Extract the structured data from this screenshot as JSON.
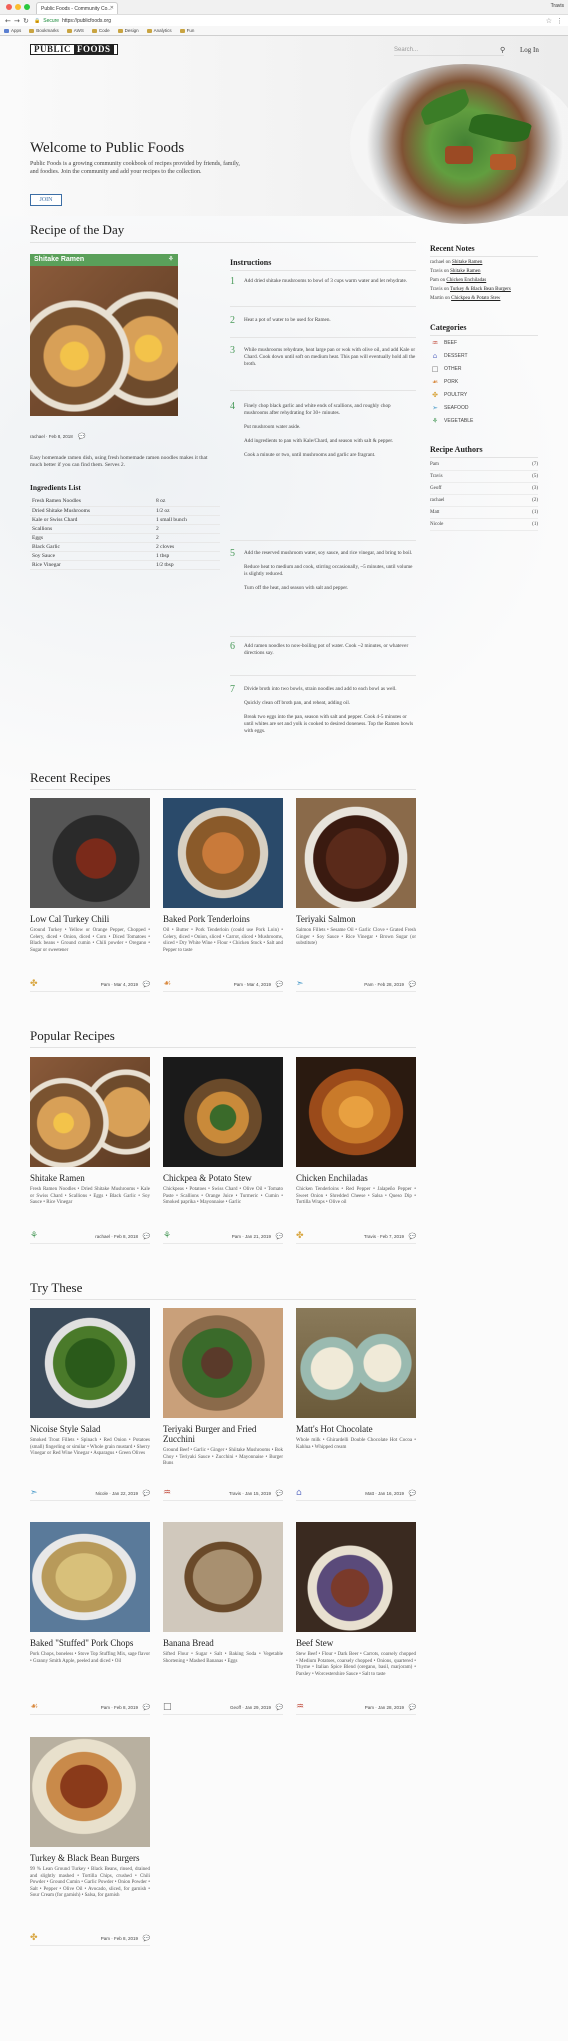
{
  "browser": {
    "tab_title": "Public Foods - Community Co...",
    "user": "Travis",
    "url_secure": "Secure",
    "url": "https://publicfoods.org",
    "bookmarks": [
      "Apps",
      "Bookmarks",
      "AWS",
      "Code",
      "Design",
      "Analytics",
      "Fun"
    ]
  },
  "header": {
    "logo_left": "PUBLIC",
    "logo_right": "FOODS",
    "search_placeholder": "Search...",
    "login": "Log In",
    "hero_title": "Welcome to Public Foods",
    "hero_sub": "Public Foods is a growing community cookbook of recipes provided by friends, family, and foodies. Join the community and add your recipes to the collection.",
    "join": "JOIN"
  },
  "rotd": {
    "section_title": "Recipe of the Day",
    "recipe_title": "Shitake Ramen",
    "author_line": "rachael · Feb 8, 2018",
    "description": "Easy homemade ramen dish, using fresh homemade ramen noodles makes it that much better if you can find them. Serves 2.",
    "ingredients_title": "Ingredients List",
    "ingredients": [
      [
        "Fresh Ramen Noodles",
        "8 oz"
      ],
      [
        "Dried Shitake Mushrooms",
        "1/2 oz"
      ],
      [
        "Kale or Swiss Chard",
        "1 small bunch"
      ],
      [
        "Scallions",
        "2"
      ],
      [
        "Eggs",
        "2"
      ],
      [
        "Black Garlic",
        "2 cloves"
      ],
      [
        "Soy Sauce",
        "1 tbsp"
      ],
      [
        "Rice Vinegar",
        "1/2 tbsp"
      ]
    ],
    "instructions_title": "Instructions",
    "steps": [
      {
        "n": "1",
        "text": "Add dried shitake mushrooms to bowl of 3 cups warm water and let rehydrate."
      },
      {
        "n": "2",
        "text": "Heat a pot of water to be used for Ramen."
      },
      {
        "n": "3",
        "text": "While mushrooms rehydrate, heat large pan or wok with olive oil, and add Kale or Chard. Cook down until soft on medium heat. This pan will eventually hold all the broth."
      },
      {
        "n": "4",
        "text": "Finely chop black garlic and white ends of scallions, and roughly chop mushrooms after rehydrating for 30+ minutes.\n\nPut mushroom water aside.\n\nAdd ingredients to pan with Kale/Chard, and season with salt & pepper.\n\nCook a minute or two, until mushrooms and garlic are fragrant."
      },
      {
        "n": "5",
        "text": "Add the reserved mushroom water, soy sauce, and rice vinegar, and bring to boil.\n\nReduce heat to medium and cook, stirring occasionally, ~5 minutes, until volume is slightly reduced.\n\nTurn off the heat, and season with salt and pepper."
      },
      {
        "n": "6",
        "text": "Add ramen noodles to now-boiling pot of water. Cook ~2 minutes, or whatever directions say."
      },
      {
        "n": "7",
        "text": "Divide broth into two bowls, strain noodles and add to each bowl as well.\n\nQuickly clean off broth pan, and reheat, adding oil.\n\nBreak two eggs into the pan, season with salt and pepper. Cook 4-5 minutes or until whites are set and yolk is cooked to desired doneness. Top the Ramen bowls with eggs."
      }
    ]
  },
  "sidebar": {
    "notes_title": "Recent Notes",
    "notes": [
      {
        "who": "rachael on",
        "what": "Shitake Ramen"
      },
      {
        "who": "Travis on",
        "what": "Shitake Ramen"
      },
      {
        "who": "Pam on",
        "what": "Chicken Enchiladas"
      },
      {
        "who": "Travis on",
        "what": "Turkey & Black Bean Burgers"
      },
      {
        "who": "Martin on",
        "what": "Chickpea & Potato Stew"
      }
    ],
    "categories_title": "Categories",
    "categories": [
      {
        "label": "BEEF",
        "icon": "cow-icon",
        "glyph": "♒"
      },
      {
        "label": "DESSERT",
        "icon": "cake-icon",
        "glyph": "⌂"
      },
      {
        "label": "OTHER",
        "icon": "box-icon",
        "glyph": "□"
      },
      {
        "label": "PORK",
        "icon": "pig-icon",
        "glyph": "☙"
      },
      {
        "label": "POULTRY",
        "icon": "chicken-icon",
        "glyph": "✤"
      },
      {
        "label": "SEAFOOD",
        "icon": "fish-icon",
        "glyph": "➣"
      },
      {
        "label": "VEGETABLE",
        "icon": "carrot-icon",
        "glyph": "⚘"
      }
    ],
    "authors_title": "Recipe Authors",
    "authors": [
      {
        "name": "Pam",
        "count": "(7)"
      },
      {
        "name": "Travis",
        "count": "(5)"
      },
      {
        "name": "Geoff",
        "count": "(3)"
      },
      {
        "name": "rachael",
        "count": "(2)"
      },
      {
        "name": "Matt",
        "count": "(1)"
      },
      {
        "name": "Nicole",
        "count": "(1)"
      }
    ]
  },
  "recent": {
    "title": "Recent Recipes",
    "cards": [
      {
        "title": "Low Cal Turkey Chili",
        "ingr": "Ground Turkey • Yellow or Orange Pepper, Chopped • Celery, diced • Onion, diced • Corn • Diced Tomatoes • Black beans • Ground cumin • Chili powder • Oregano • Sugar or sweetener",
        "meta": "Pam · Mar 4, 2019",
        "icon": "chicken-icon",
        "glyph": "✤",
        "color": "#d9a640"
      },
      {
        "title": "Baked Pork Tenderloins",
        "ingr": "Oil • Butter • Pork Tenderloin (could use Pork Loin) • Celery, diced • Onion, sliced • Carrot, sliced • Mushrooms, sliced • Dry White Wine • Flour • Chicken Stock • Salt and Pepper to taste",
        "meta": "Pam · Mar 4, 2019",
        "icon": "pig-icon",
        "glyph": "☙",
        "color": "#d98a40"
      },
      {
        "title": "Teriyaki Salmon",
        "ingr": "Salmon Fillets • Sesame Oil • Garlic Clove • Grated Fresh Ginger • Soy Sauce • Rice Vinegar • Brown Sugar (or substitute)",
        "meta": "Pam · Feb 28, 2019",
        "icon": "fish-icon",
        "glyph": "➣",
        "color": "#4a9ac9"
      }
    ]
  },
  "popular": {
    "title": "Popular Recipes",
    "cards": [
      {
        "title": "Shitake Ramen",
        "ingr": "Fresh Ramen Noodles • Dried Shitake Mushrooms • Kale or Swiss Chard • Scallions • Eggs • Black Garlic • Soy Sauce • Rice Vinegar",
        "meta": "rachael · Feb 8, 2018",
        "icon": "carrot-icon",
        "glyph": "⚘",
        "color": "#4a9a5a"
      },
      {
        "title": "Chickpea & Potato Stew",
        "ingr": "Chickpeas • Potatoes • Swiss Chard • Olive Oil • Tomato Paste • Scallions • Orange Juice • Turmeric • Cumin • Smoked paprika • Mayonnaise • Garlic",
        "meta": "Pam · Jan 21, 2019",
        "icon": "carrot-icon",
        "glyph": "⚘",
        "color": "#4a9a5a"
      },
      {
        "title": "Chicken Enchiladas",
        "ingr": "Chicken Tenderloins • Red Pepper • Jalapeño Pepper • Sweet Onion • Shredded Cheese • Salsa • Queso Dip • Tortilla Wraps • Olive oil",
        "meta": "Travis · Feb 7, 2019",
        "icon": "chicken-icon",
        "glyph": "✤",
        "color": "#d9a640"
      }
    ]
  },
  "try": {
    "title": "Try These",
    "cards": [
      {
        "title": "Nicoise Style Salad",
        "ingr": "Smoked Trout Fillets • Spinach • Red Onion • Potatoes (small) fingerling or similar • Whole grain mustard • Sherry Vinegar or Red Wine Vinegar • Asparagus • Green Olives",
        "meta": "Nicole · Jan 22, 2019",
        "icon": "fish-icon",
        "glyph": "➣",
        "color": "#4a9ac9"
      },
      {
        "title": "Teriyaki Burger and Fried Zucchini",
        "ingr": "Ground Beef • Garlic • Ginger • Shiitake Mushrooms • Bok Choy • Teriyaki Sauce • Zucchini • Mayonnaise • Burger Buns",
        "meta": "Travis · Jan 15, 2019",
        "icon": "cow-icon",
        "glyph": "♒",
        "color": "#c04a3a"
      },
      {
        "title": "Matt's Hot Chocolate",
        "ingr": "Whole milk • Ghirardelli Double Chocolate Hot Cocoa • Kahlua • Whipped cream",
        "meta": "Matt · Jan 16, 2019",
        "icon": "cake-icon",
        "glyph": "⌂",
        "color": "#6a7ac9"
      },
      {
        "title": "Baked \"Stuffed\" Pork Chops",
        "ingr": "Pork Chops, boneless • Stove Top Stuffing Mix, sage flavor • Granny Smith Apple, peeled and diced • Oil",
        "meta": "Pam · Feb 8, 2019",
        "icon": "pig-icon",
        "glyph": "☙",
        "color": "#d98a40"
      },
      {
        "title": "Banana Bread",
        "ingr": "Sifted Flour • Sugar • Salt • Baking Soda • Vegetable Shortening • Mashed Bananas • Eggs",
        "meta": "Geoff · Jan 29, 2019",
        "icon": "box-icon",
        "glyph": "□",
        "color": "#666"
      },
      {
        "title": "Beef Stew",
        "ingr": "Stew Beef • Flour • Dark Beer • Carrots, coarsely chopped • Medium Potatoes, coarsely chopped • Onions, quartered • Thyme • Italian Spice Blend (oregano, basil, marjoram) • Parsley • Worcestershire Sauce • Salt to taste",
        "meta": "Pam · Jan 28, 2019",
        "icon": "cow-icon",
        "glyph": "♒",
        "color": "#c04a3a"
      },
      {
        "title": "Turkey & Black Bean Burgers",
        "ingr": "99 % Lean Ground Turkey • Black Beans, rinsed, drained and slightly mashed • Tortilla Chips, crushed • Chili Powder • Ground Cumin • Garlic Powder • Onion Powder • Salt • Pepper • Olive Oil • Avocado, sliced, for garnish • Sour Cream (for garnish) • Salsa, for garnish",
        "meta": "Pam · Feb 8, 2019",
        "icon": "chicken-icon",
        "glyph": "✤",
        "color": "#d9a640"
      }
    ]
  }
}
